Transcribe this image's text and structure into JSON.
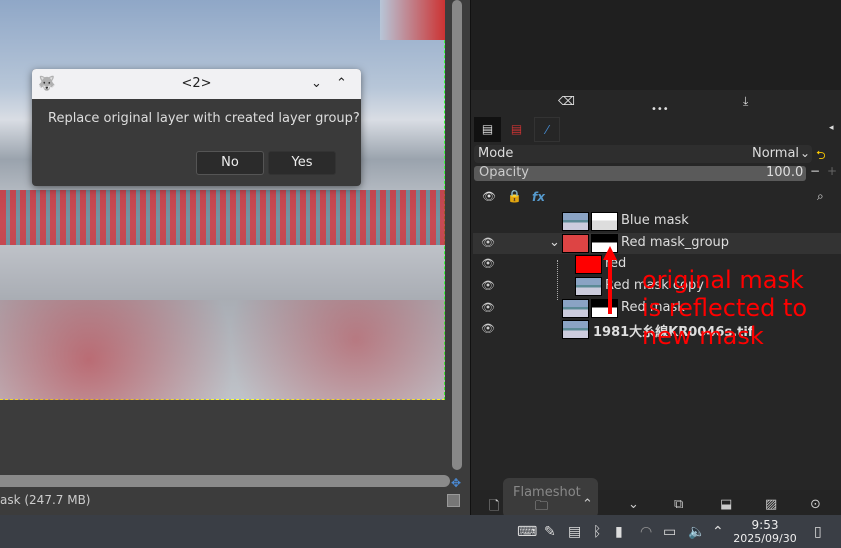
{
  "dialog": {
    "title": "<2>",
    "message": "Replace original layer with created layer group?",
    "no_label": "No",
    "yes_label": "Yes"
  },
  "status": {
    "text": "ask (247.7 MB)"
  },
  "layers_panel": {
    "mode_label": "Mode",
    "mode_value": "Normal",
    "opacity_label": "Opacity",
    "opacity_value": "100.0",
    "layers": [
      {
        "name": "Blue mask",
        "visible": false
      },
      {
        "name": "Red mask_group",
        "visible": true
      },
      {
        "name": "red",
        "visible": true
      },
      {
        "name": "Red mask copy",
        "visible": true
      },
      {
        "name": "Red mask",
        "visible": true
      },
      {
        "name": "1981大糸線KR0046s.tif",
        "visible": true
      }
    ]
  },
  "annotation": {
    "line1": "original mask",
    "line2": "is reflected to",
    "line3": "new mask",
    "color": "#ff0000"
  },
  "tooltip": {
    "text": "Flameshot"
  },
  "taskbar": {
    "time": "9:53",
    "date": "2025/09/30"
  }
}
